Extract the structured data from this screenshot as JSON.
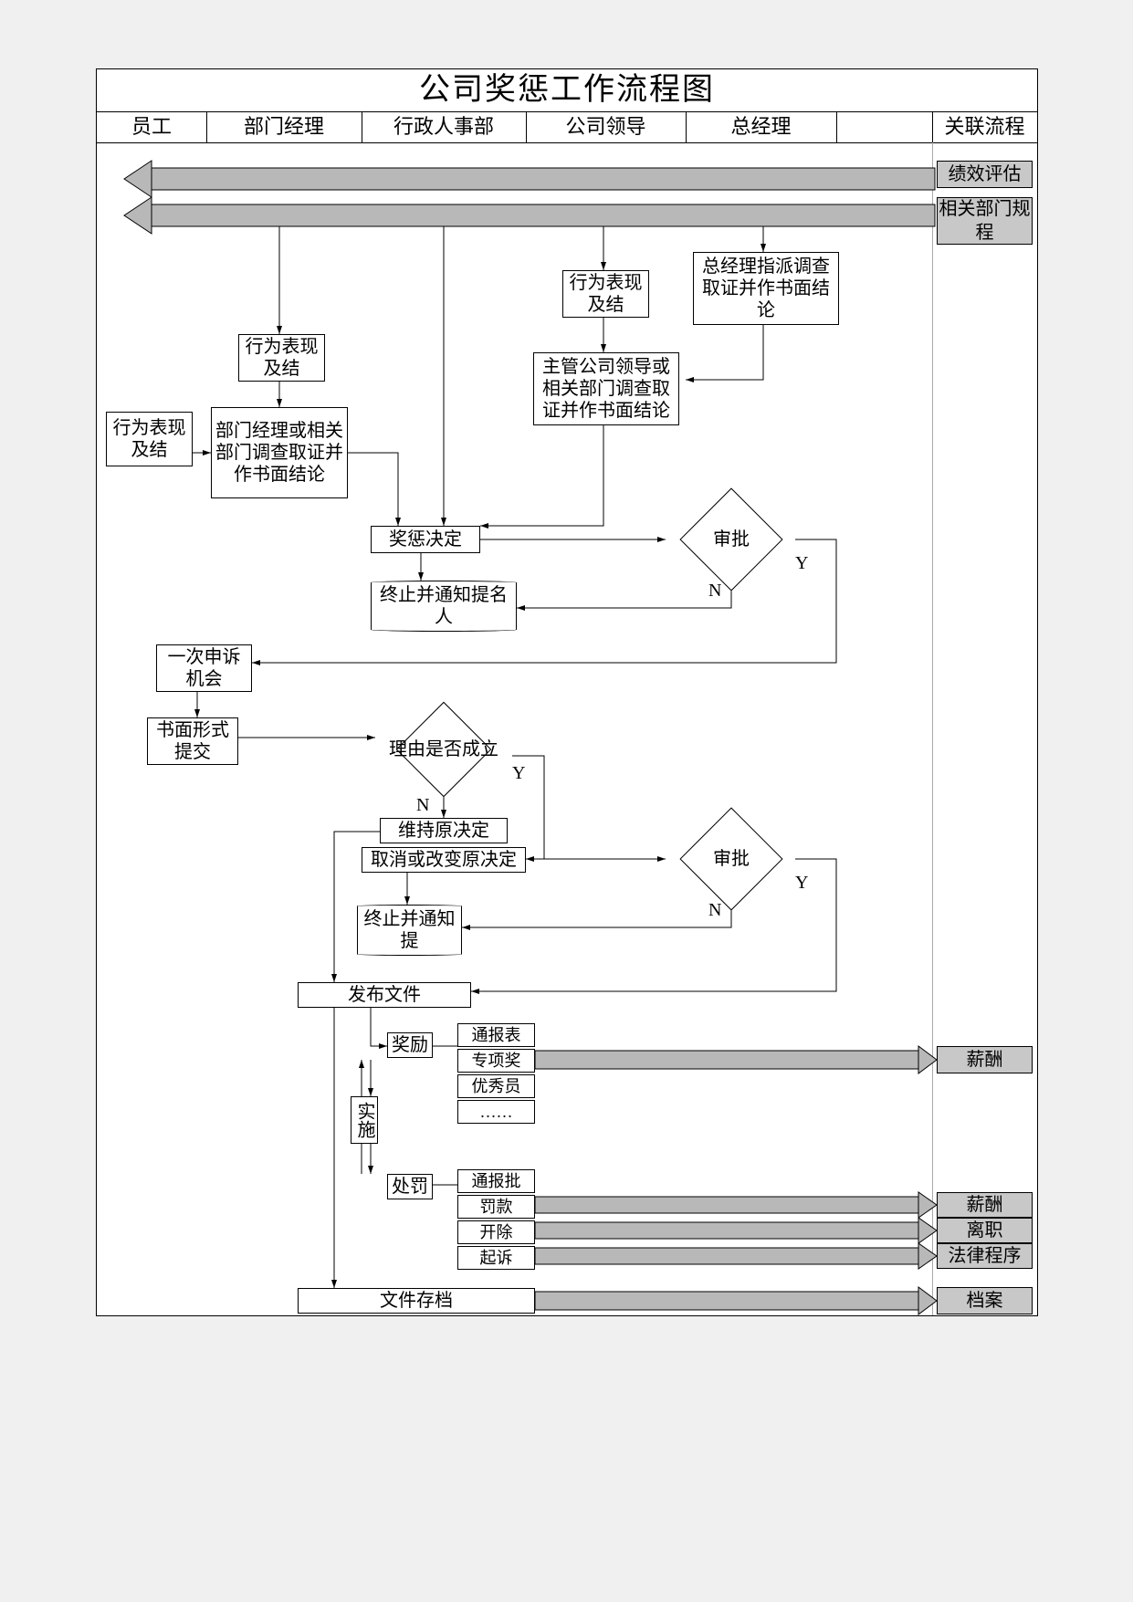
{
  "title": "公司奖惩工作流程图",
  "columns": [
    "员工",
    "部门经理",
    "行政人事部",
    "公司领导",
    "总经理",
    "关联流程"
  ],
  "related": {
    "perf": "绩效评估",
    "dept_rules": "相关部门规程",
    "salary": "薪酬",
    "salary2": "薪酬",
    "leave": "离职",
    "legal": "法律程序",
    "archive": "档案"
  },
  "nodes": {
    "emp_behavior": "行为表现及结",
    "mgr_behavior": "行为表现及结",
    "leader_behavior": "行为表现及结",
    "mgr_investigation": "部门经理或相关部门调查取证并作书面结论",
    "leader_investigation": "主管公司领导或相关部门调查取证并作书面结论",
    "gm_investigation": "总经理指派调查取证并作书面结论",
    "decision": "奖惩决定",
    "approval1": "审批",
    "terminate1": "终止并通知提名人",
    "appeal": "一次申诉机会",
    "written": "书面形式提交",
    "reason": "理由是否成立",
    "maintain": "维持原决定",
    "change": "取消或改变原决定",
    "approval2": "审批",
    "terminate2": "终止并通知提",
    "publish": "发布文件",
    "reward": "奖励",
    "punish": "处罚",
    "impl": "实施",
    "commend": "通报表",
    "special": "专项奖",
    "excellent": "优秀员",
    "dots": "……",
    "criticize": "通报批",
    "fine": "罚款",
    "dismiss": "开除",
    "sue": "起诉",
    "archive_doc": "文件存档"
  },
  "labels": {
    "Y": "Y",
    "N": "N"
  }
}
